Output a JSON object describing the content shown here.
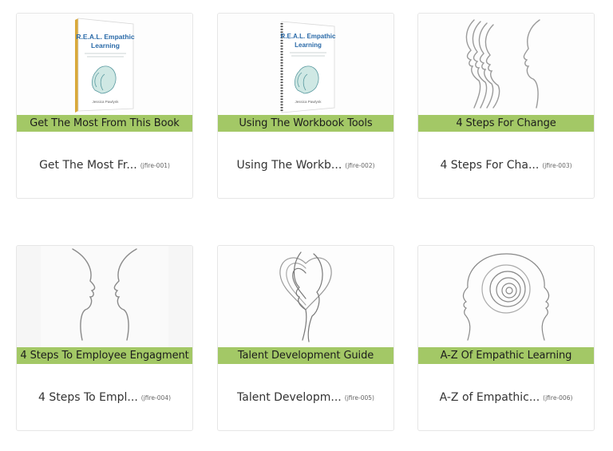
{
  "cards": [
    {
      "banner": "Get The Most From This Book",
      "name": "Get The Most Fr...",
      "code": "(jfire-001)",
      "image": "workbook-cover",
      "book": {
        "title_line1": "R.E.A.L. Empathic",
        "title_line2": "Learning",
        "author": "Jessica Pawlynk"
      }
    },
    {
      "banner": "Using The Workbook Tools",
      "name": "Using The Workb...",
      "code": "(jfire-002)",
      "image": "spiral-workbook-cover",
      "book": {
        "title_line1": "R.E.A.L. Empathic",
        "title_line2": "Learning",
        "author": "Jessica Pawlynk"
      }
    },
    {
      "banner": "4 Steps For Change",
      "name": "4 Steps For Cha...",
      "code": "(jfire-003)",
      "image": "layered-profiles"
    },
    {
      "banner": "4 Steps To Employee Engagment",
      "name": "4 Steps To Empl...",
      "code": "(jfire-004)",
      "image": "facing-profiles"
    },
    {
      "banner": "Talent Development Guide",
      "name": "Talent Developm...",
      "code": "(jfire-005)",
      "image": "heart-profiles"
    },
    {
      "banner": "A-Z Of Empathic Learning",
      "name": "A-Z of Empathic...",
      "code": "(jfire-006)",
      "image": "head-with-rings"
    }
  ],
  "colors": {
    "banner": "#a3c866",
    "border": "#e6e6e6"
  }
}
